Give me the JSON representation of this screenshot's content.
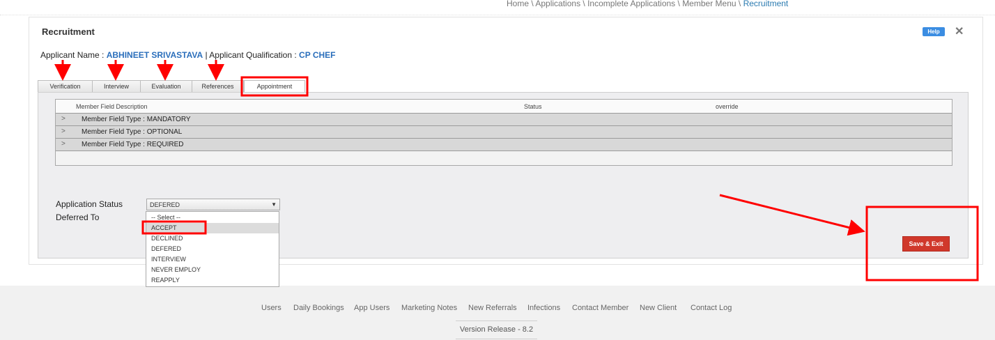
{
  "breadcrumb": {
    "items": [
      "Home",
      "Applications",
      "Incomplete Applications",
      "Member Menu"
    ],
    "separator": " \\ ",
    "current": "Recruitment"
  },
  "panel": {
    "title": "Recruitment",
    "help_label": "Help",
    "close_icon": "close-icon"
  },
  "applicant": {
    "name_label": "Applicant Name : ",
    "name_value": "ABHINEET SRIVASTAVA",
    "qual_label": " | Applicant Qualification : ",
    "qual_value": "CP CHEF"
  },
  "tabs": [
    {
      "label": "Verification",
      "active": false
    },
    {
      "label": "Interview",
      "active": false
    },
    {
      "label": "Evaluation",
      "active": false
    },
    {
      "label": "References",
      "active": false
    },
    {
      "label": "Appointment",
      "active": true
    }
  ],
  "grid": {
    "columns": [
      "Member Field Description",
      "Status",
      "override"
    ],
    "rows": [
      "Member Field Type : MANDATORY",
      "Member Field Type : OPTIONAL",
      "Member Field Type : REQUIRED"
    ]
  },
  "form": {
    "status_label": "Application Status",
    "deferred_label": "Deferred To",
    "status_value": "DEFERED",
    "options": [
      "-- Select --",
      "ACCEPT",
      "DECLINED",
      "DEFERED",
      "INTERVIEW",
      "NEVER EMPLOY",
      "REAPPLY"
    ],
    "highlighted_option": "ACCEPT"
  },
  "save_button": "Save & Exit",
  "footer": {
    "links": [
      "Users",
      "Daily Bookings",
      "App Users",
      "Marketing Notes",
      "New Referrals",
      "Infections",
      "Contact Member",
      "New Client",
      "Contact Log"
    ],
    "version": "Version Release - 8.2"
  },
  "colors": {
    "link_blue": "#2a6ebb",
    "help_blue": "#3b8de2",
    "save_red": "#d0382b",
    "annotation_red": "#ff0000"
  }
}
